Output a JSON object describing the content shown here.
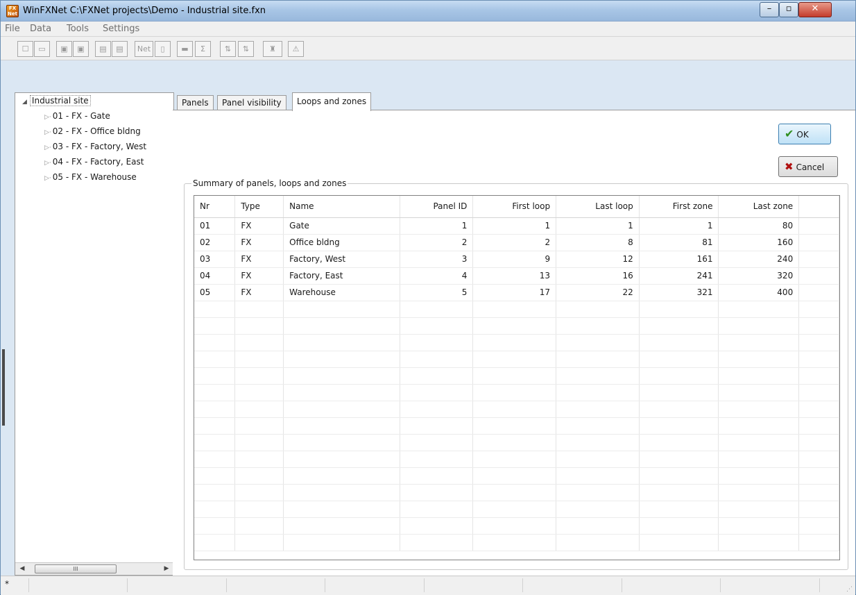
{
  "window": {
    "title": "WinFXNet C:\\FXNet projects\\Demo - Industrial site.fxn",
    "icon_text": "FX Net"
  },
  "menu": [
    "File",
    "Data",
    "Tools",
    "Settings"
  ],
  "toolbar": [
    {
      "name": "new-icon",
      "glyph": "☐"
    },
    {
      "name": "open-icon",
      "glyph": "▭"
    },
    {
      "name": "save-icon",
      "glyph": "▣"
    },
    {
      "name": "save-as-icon",
      "glyph": "▣"
    },
    {
      "name": "print-icon",
      "glyph": "▤"
    },
    {
      "name": "print-setup-icon",
      "glyph": "▤"
    },
    {
      "name": "net-icon",
      "glyph": "Net"
    },
    {
      "name": "panel-icon",
      "glyph": "▯"
    },
    {
      "name": "display-icon",
      "glyph": "▬"
    },
    {
      "name": "sum-icon",
      "glyph": "Σ"
    },
    {
      "name": "upload-icon",
      "glyph": "⇅"
    },
    {
      "name": "download-icon",
      "glyph": "⇅"
    },
    {
      "name": "tower-icon",
      "glyph": "♜"
    },
    {
      "name": "alarm-icon",
      "glyph": "⚠"
    }
  ],
  "tree": {
    "root": "Industrial site",
    "items": [
      "01 - FX - Gate",
      "02 - FX - Office bldng",
      "03 - FX - Factory, West",
      "04 - FX - Factory, East",
      "05 - FX - Warehouse"
    ],
    "scroll_thumb": "III"
  },
  "tabs": [
    "Panels",
    "Panel visibility",
    "Loops and zones"
  ],
  "active_tab": 2,
  "buttons": {
    "ok": "OK",
    "cancel": "Cancel"
  },
  "group_title": "Summary of panels, loops and zones",
  "table": {
    "columns": [
      "Nr",
      "Type",
      "Name",
      "Panel ID",
      "First loop",
      "Last loop",
      "First zone",
      "Last zone"
    ],
    "rows": [
      [
        "01",
        "FX",
        "Gate",
        "1",
        "1",
        "1",
        "1",
        "80"
      ],
      [
        "02",
        "FX",
        "Office bldng",
        "2",
        "2",
        "8",
        "81",
        "160"
      ],
      [
        "03",
        "FX",
        "Factory, West",
        "3",
        "9",
        "12",
        "161",
        "240"
      ],
      [
        "04",
        "FX",
        "Factory, East",
        "4",
        "13",
        "16",
        "241",
        "320"
      ],
      [
        "05",
        "FX",
        "Warehouse",
        "5",
        "17",
        "22",
        "321",
        "400"
      ]
    ]
  },
  "status": {
    "text": "*"
  }
}
